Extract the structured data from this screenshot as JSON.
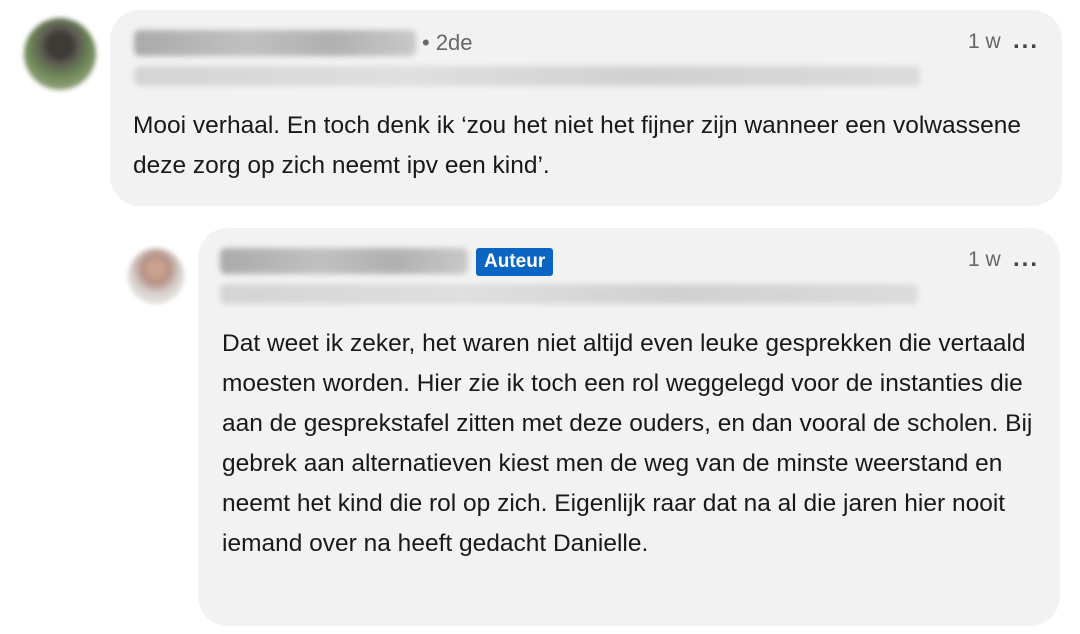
{
  "comments": [
    {
      "degree": "• 2de",
      "time": "1 w",
      "more": "...",
      "text": "Mooi verhaal. En toch denk ik ‘zou het niet het fijner zijn wanneer een volwassene deze zorg op zich neemt ipv een kind’."
    },
    {
      "badge": "Auteur",
      "time": "1 w",
      "more": "...",
      "text": "Dat weet ik zeker, het waren niet altijd even leuke gesprekken die vertaald moesten worden. Hier zie ik toch een rol weggelegd voor de instanties die aan de gesprekstafel zitten met deze ouders, en dan vooral de scholen. Bij gebrek aan alternatieven kiest men de weg van de minste weerstand en neemt het kind die rol op zich. Eigenlijk raar dat na al die jaren hier nooit iemand over na heeft gedacht Danielle."
    }
  ],
  "colors": {
    "bubble": "#f2f2f2",
    "badge": "#0a66c2",
    "muted_text": "#666666"
  }
}
